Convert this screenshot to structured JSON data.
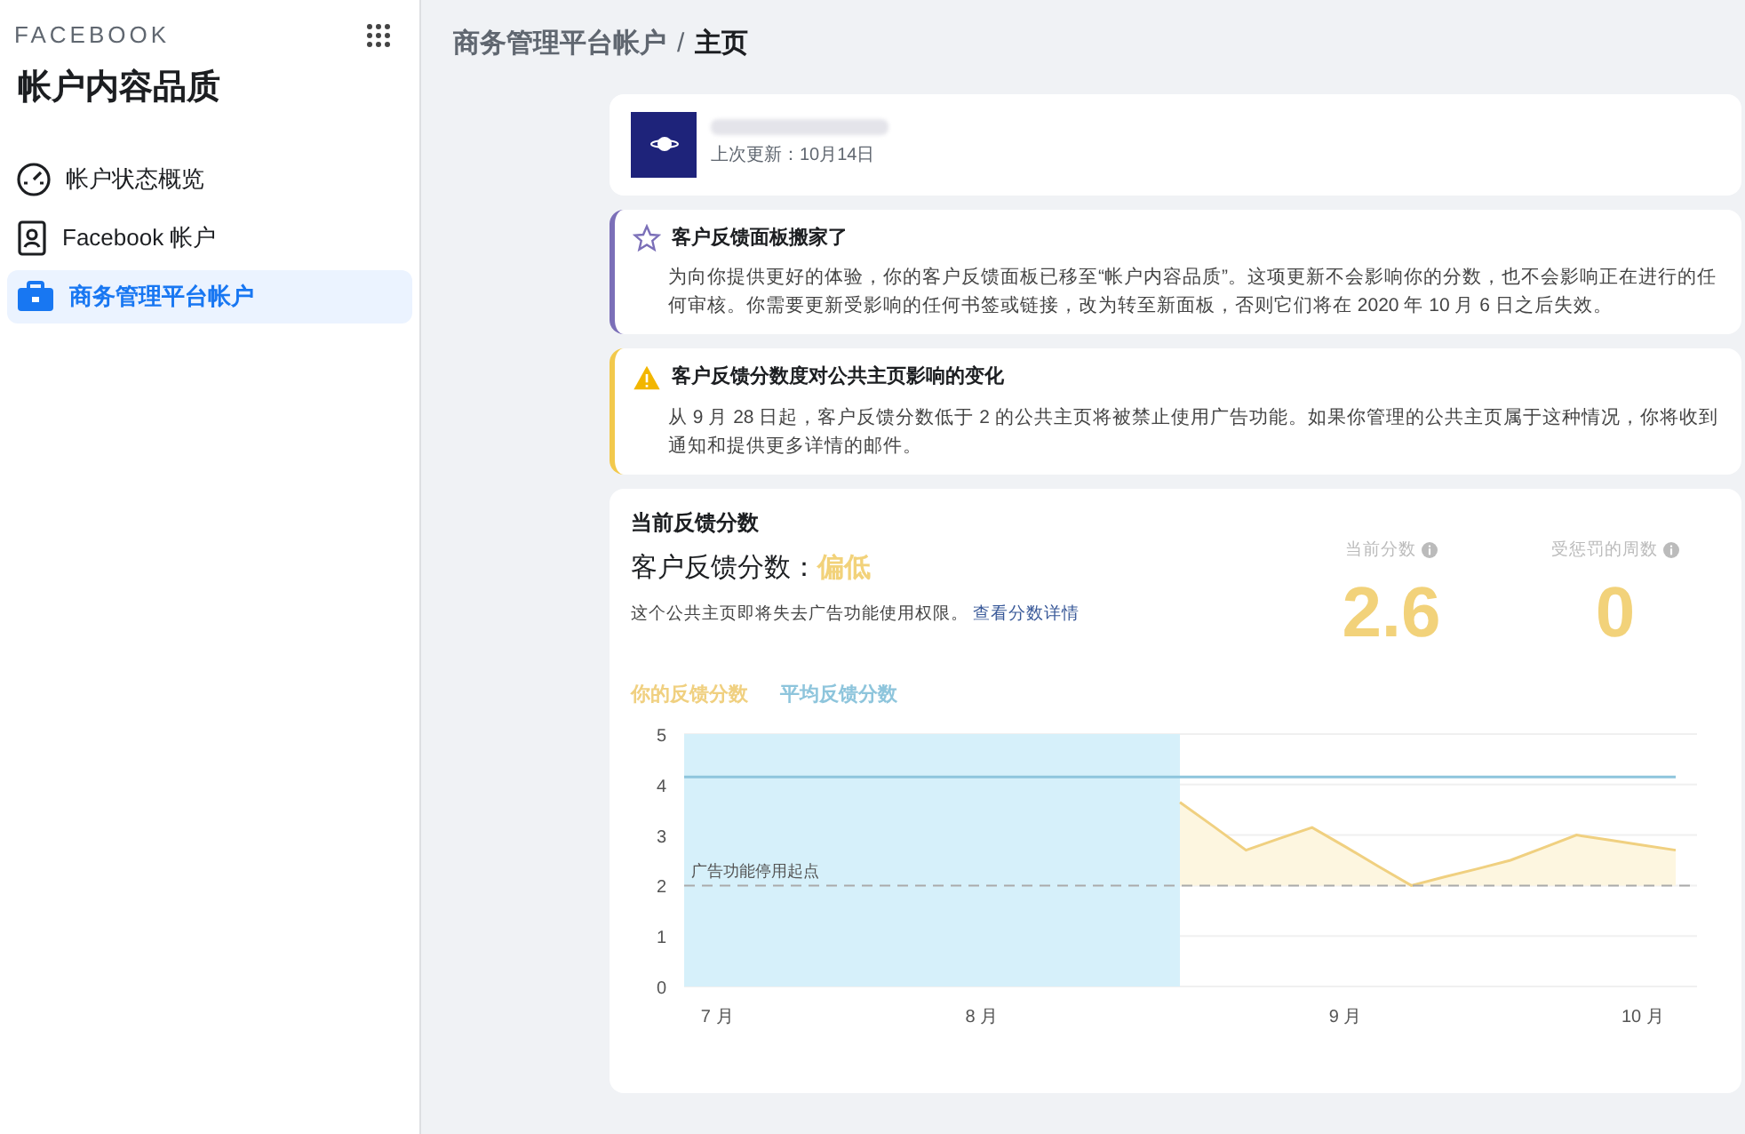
{
  "sidebar": {
    "brand": "FACEBOOK",
    "title": "帐户内容品质",
    "items": [
      {
        "label": "帐户状态概览",
        "selected": false
      },
      {
        "label": "Facebook 帐户",
        "selected": false
      },
      {
        "label": "商务管理平台帐户",
        "selected": true
      }
    ]
  },
  "breadcrumb": {
    "items": [
      "商务管理平台帐户",
      "主页"
    ],
    "separator": "/"
  },
  "page_card": {
    "updated": "上次更新：10月14日"
  },
  "notices": [
    {
      "kind": "info",
      "title": "客户反馈面板搬家了",
      "body": "为向你提供更好的体验，你的客户反馈面板已移至“帐户内容品质”。这项更新不会影响你的分数，也不会影响正在进行的任何审核。你需要更新受影响的任何书签或链接，改为转至新面板，否则它们将在 2020 年 10 月 6 日之后失效。"
    },
    {
      "kind": "warning",
      "title": "客户反馈分数度对公共主页影响的变化",
      "body": "从 9 月 28 日起，客户反馈分数低于 2 的公共主页将被禁止使用广告功能。如果你管理的公共主页属于这种情况，你将收到通知和提供更多详情的邮件。"
    }
  ],
  "score_card": {
    "heading": "当前反馈分数",
    "score_label": "客户反馈分数：",
    "score_level": "偏低",
    "description": "这个公共主页即将失去广告功能使用权限。",
    "link": "查看分数详情",
    "stats": [
      {
        "label": "当前分数",
        "value": "2.6"
      },
      {
        "label": "受惩罚的周数",
        "value": "0"
      }
    ],
    "chart_data": {
      "type": "line",
      "categories": [
        null,
        "7 月",
        null,
        null,
        null,
        null,
        null,
        null,
        null,
        "8 月",
        null,
        null,
        null,
        null,
        null,
        null,
        null,
        null,
        null,
        null,
        "9 月",
        null,
        null,
        null,
        null,
        null,
        null,
        null,
        null,
        "10 月",
        null
      ],
      "series": [
        {
          "name": "你的反馈分数",
          "color": "#f0d080",
          "values": [
            null,
            null,
            null,
            null,
            null,
            null,
            null,
            null,
            null,
            null,
            null,
            null,
            null,
            null,
            null,
            3.65,
            3.18,
            2.7,
            2.93,
            3.15,
            2.77,
            2.38,
            2.0,
            2.17,
            2.33,
            2.5,
            2.75,
            3.0,
            2.9,
            2.8,
            2.7
          ]
        },
        {
          "name": "平均反馈分数",
          "color": "#8ec5dc",
          "values": [
            4.15,
            4.15,
            4.15,
            4.15,
            4.15,
            4.15,
            4.15,
            4.15,
            4.15,
            4.15,
            4.15,
            4.15,
            4.15,
            4.15,
            4.15,
            4.15,
            4.15,
            4.15,
            4.15,
            4.15,
            4.15,
            4.15,
            4.15,
            4.15,
            4.15,
            4.15,
            4.15,
            4.15,
            4.15,
            4.15,
            4.15
          ]
        }
      ],
      "ylim": [
        0,
        5
      ],
      "grid": true,
      "yticks": [
        0,
        1,
        2,
        3,
        4,
        5
      ],
      "ref_lines": [
        {
          "axis": "y",
          "value": 2,
          "label": "广告功能停用起点"
        }
      ]
    }
  }
}
